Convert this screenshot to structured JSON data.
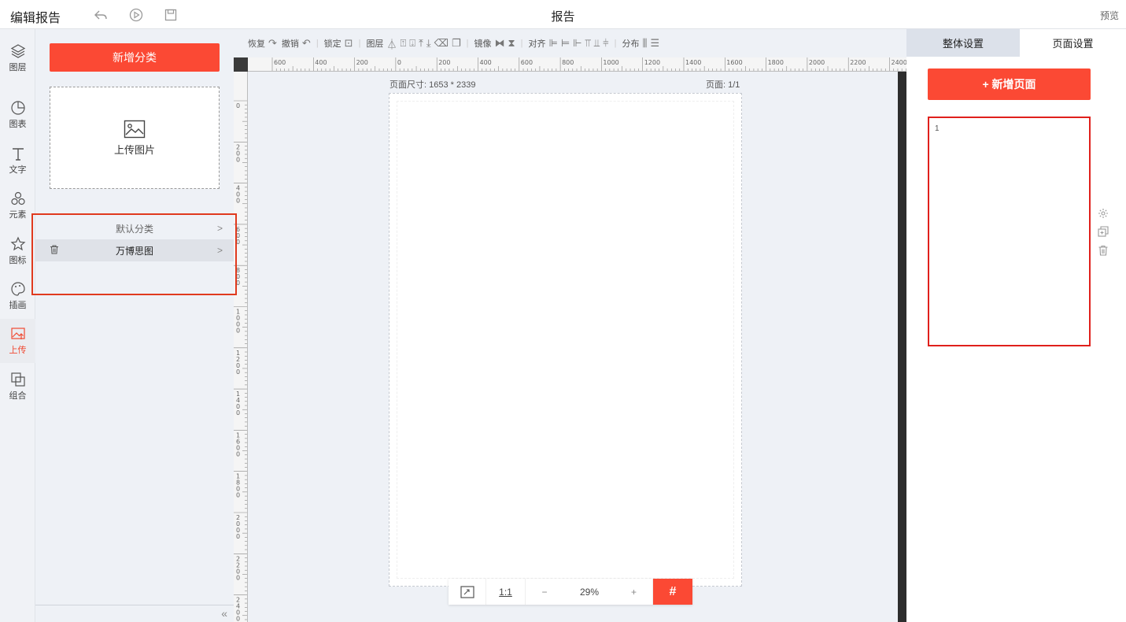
{
  "header": {
    "app_title": "编辑报告",
    "center_title": "报告",
    "preview_label": "预览"
  },
  "iconbar": {
    "items": [
      {
        "label": "图层",
        "icon": "layers-icon"
      },
      {
        "label": "图表",
        "icon": "chart-icon"
      },
      {
        "label": "文字",
        "icon": "text-icon"
      },
      {
        "label": "元素",
        "icon": "elements-icon"
      },
      {
        "label": "图标",
        "icon": "star-icon"
      },
      {
        "label": "插画",
        "icon": "palette-icon"
      },
      {
        "label": "上传",
        "icon": "upload-image-icon"
      },
      {
        "label": "组合",
        "icon": "combine-icon"
      }
    ],
    "active_color": "#f04a33"
  },
  "panel": {
    "add_category_label": "新增分类",
    "upload_label": "上传图片",
    "categories": [
      {
        "label": "默认分类"
      },
      {
        "label": "万博思图"
      }
    ]
  },
  "toolbar": {
    "redo": "恢复",
    "undo": "撤销",
    "lock": "锁定",
    "layer": "图层",
    "mirror": "镜像",
    "align": "对齐",
    "distribute": "分布"
  },
  "ruler": {
    "h_ticks": [
      "600",
      "400",
      "200",
      "0",
      "200",
      "400",
      "600",
      "800",
      "1000",
      "1200",
      "1400",
      "1600",
      "1800",
      "2000",
      "2200",
      "2400"
    ],
    "v_ticks": [
      "0",
      "200",
      "400",
      "600",
      "800",
      "1000",
      "1200",
      "1400",
      "1600",
      "1800",
      "2000",
      "2200",
      "2400"
    ]
  },
  "canvas": {
    "page_size_text": "页面尺寸: 1653 * 2339",
    "page_index_text": "页面: 1/1"
  },
  "zoom": {
    "fit_label": "fit-screen-icon",
    "one_to_one": "1:1",
    "minus": "−",
    "value": "29%",
    "plus": "+",
    "grid_icon": "grid-icon"
  },
  "rightpanel": {
    "tabs": [
      {
        "label": "整体设置"
      },
      {
        "label": "页面设置"
      }
    ],
    "add_page_label": "+ 新增页面",
    "thumbnail_number": "1"
  },
  "colors": {
    "brand_red": "#fb4934",
    "highlight_border": "#e03a1e"
  }
}
